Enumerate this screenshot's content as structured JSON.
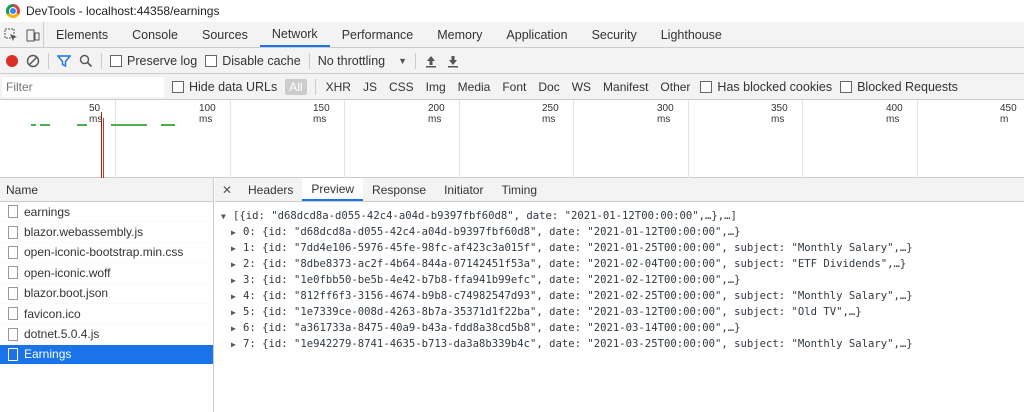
{
  "window": {
    "title": "DevTools - localhost:44358/earnings"
  },
  "tabs": [
    "Elements",
    "Console",
    "Sources",
    "Network",
    "Performance",
    "Memory",
    "Application",
    "Security",
    "Lighthouse"
  ],
  "toolbar": {
    "preserve_log": "Preserve log",
    "disable_cache": "Disable cache",
    "throttling": "No throttling"
  },
  "filterbar": {
    "placeholder": "Filter",
    "hide_data_urls": "Hide data URLs",
    "types": [
      "All",
      "XHR",
      "JS",
      "CSS",
      "Img",
      "Media",
      "Font",
      "Doc",
      "WS",
      "Manifest",
      "Other"
    ],
    "has_blocked_cookies": "Has blocked cookies",
    "blocked_requests": "Blocked Requests"
  },
  "timeline": {
    "ticks": [
      "50 ms",
      "100 ms",
      "150 ms",
      "200 ms",
      "250 ms",
      "300 ms",
      "350 ms",
      "400 ms",
      "450 m"
    ]
  },
  "requests": {
    "header": "Name",
    "items": [
      "earnings",
      "blazor.webassembly.js",
      "open-iconic-bootstrap.min.css",
      "open-iconic.woff",
      "blazor.boot.json",
      "favicon.ico",
      "dotnet.5.0.4.js",
      "Earnings"
    ]
  },
  "detail_tabs": [
    "Headers",
    "Preview",
    "Response",
    "Initiator",
    "Timing"
  ],
  "preview": {
    "root": "[{id: \"d68dcd8a-d055-42c4-a04d-b9397fbf60d8\", date: \"2021-01-12T00:00:00\",…},…]",
    "items": [
      "0: {id: \"d68dcd8a-d055-42c4-a04d-b9397fbf60d8\", date: \"2021-01-12T00:00:00\",…}",
      "1: {id: \"7dd4e106-5976-45fe-98fc-af423c3a015f\", date: \"2021-01-25T00:00:00\", subject: \"Monthly Salary\",…}",
      "2: {id: \"8dbe8373-ac2f-4b64-844a-07142451f53a\", date: \"2021-02-04T00:00:00\", subject: \"ETF Dividends\",…}",
      "3: {id: \"1e0fbb50-be5b-4e42-b7b8-ffa941b99efc\", date: \"2021-02-12T00:00:00\",…}",
      "4: {id: \"812ff6f3-3156-4674-b9b8-c74982547d93\", date: \"2021-02-25T00:00:00\", subject: \"Monthly Salary\",…}",
      "5: {id: \"1e7339ce-008d-4263-8b7a-35371d1f22ba\", date: \"2021-03-12T00:00:00\", subject: \"Old TV\",…}",
      "6: {id: \"a361733a-8475-40a9-b43a-fdd8a38cd5b8\", date: \"2021-03-14T00:00:00\",…}",
      "7: {id: \"1e942279-8741-4635-b713-da3a8b339b4c\", date: \"2021-03-25T00:00:00\", subject: \"Monthly Salary\",…}"
    ]
  }
}
